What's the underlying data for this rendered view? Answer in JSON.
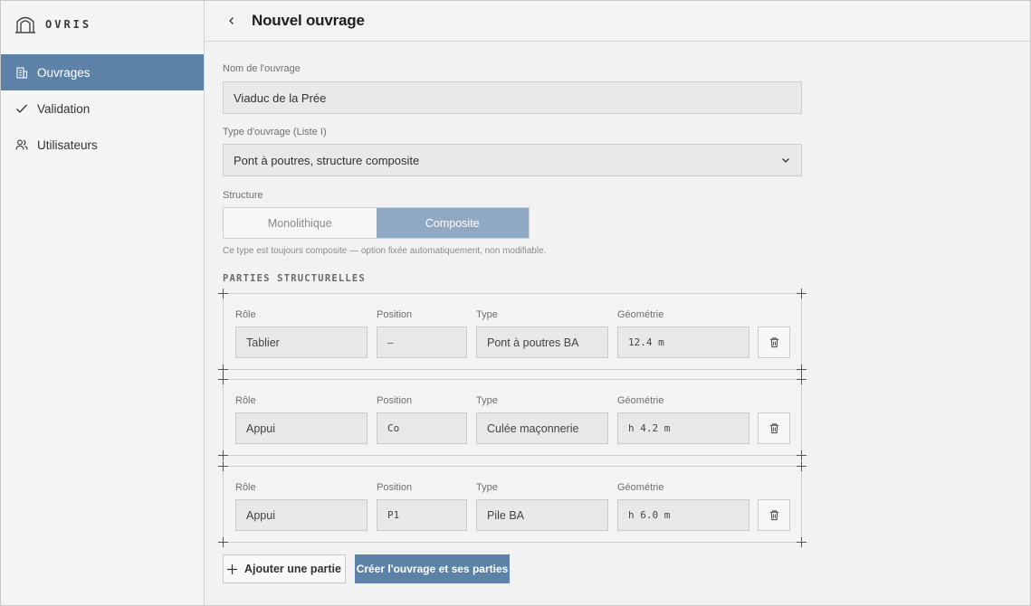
{
  "app": {
    "name": "OVRIS"
  },
  "sidebar": {
    "items": [
      {
        "label": "Ouvrages",
        "icon": "building-icon",
        "active": true
      },
      {
        "label": "Validation",
        "icon": "check-icon",
        "active": false
      },
      {
        "label": "Utilisateurs",
        "icon": "users-icon",
        "active": false
      }
    ]
  },
  "header": {
    "title": "Nouvel ouvrage"
  },
  "form": {
    "name_label": "Nom de l'ouvrage",
    "name_value": "Viaduc de la Prée",
    "type_label": "Type d'ouvrage (Liste I)",
    "type_value": "Pont à poutres, structure composite",
    "structure_label": "Structure",
    "structure_options": [
      "Monolithique",
      "Composite"
    ],
    "structure_selected": "Composite",
    "structure_hint": "Ce type est toujours composite — option fixée automatiquement, non modifiable.",
    "section_title": "PARTIES STRUCTURELLES",
    "columns": {
      "role": "Rôle",
      "position": "Position",
      "type": "Type",
      "geometry": "Géométrie"
    },
    "parts": [
      {
        "role": "Tablier",
        "position": "—",
        "type": "Pont à poutres BA",
        "geometry": "12.4 m"
      },
      {
        "role": "Appui",
        "position": "Co",
        "type": "Culée maçonnerie",
        "geometry": "h 4.2 m"
      },
      {
        "role": "Appui",
        "position": "P1",
        "type": "Pile BA",
        "geometry": "h 6.0 m"
      }
    ],
    "add_button": "Ajouter une partie",
    "create_button": "Créer l'ouvrage et ses parties"
  },
  "colors": {
    "accent": "#5d82a8",
    "segment_active": "#91a8c2"
  }
}
